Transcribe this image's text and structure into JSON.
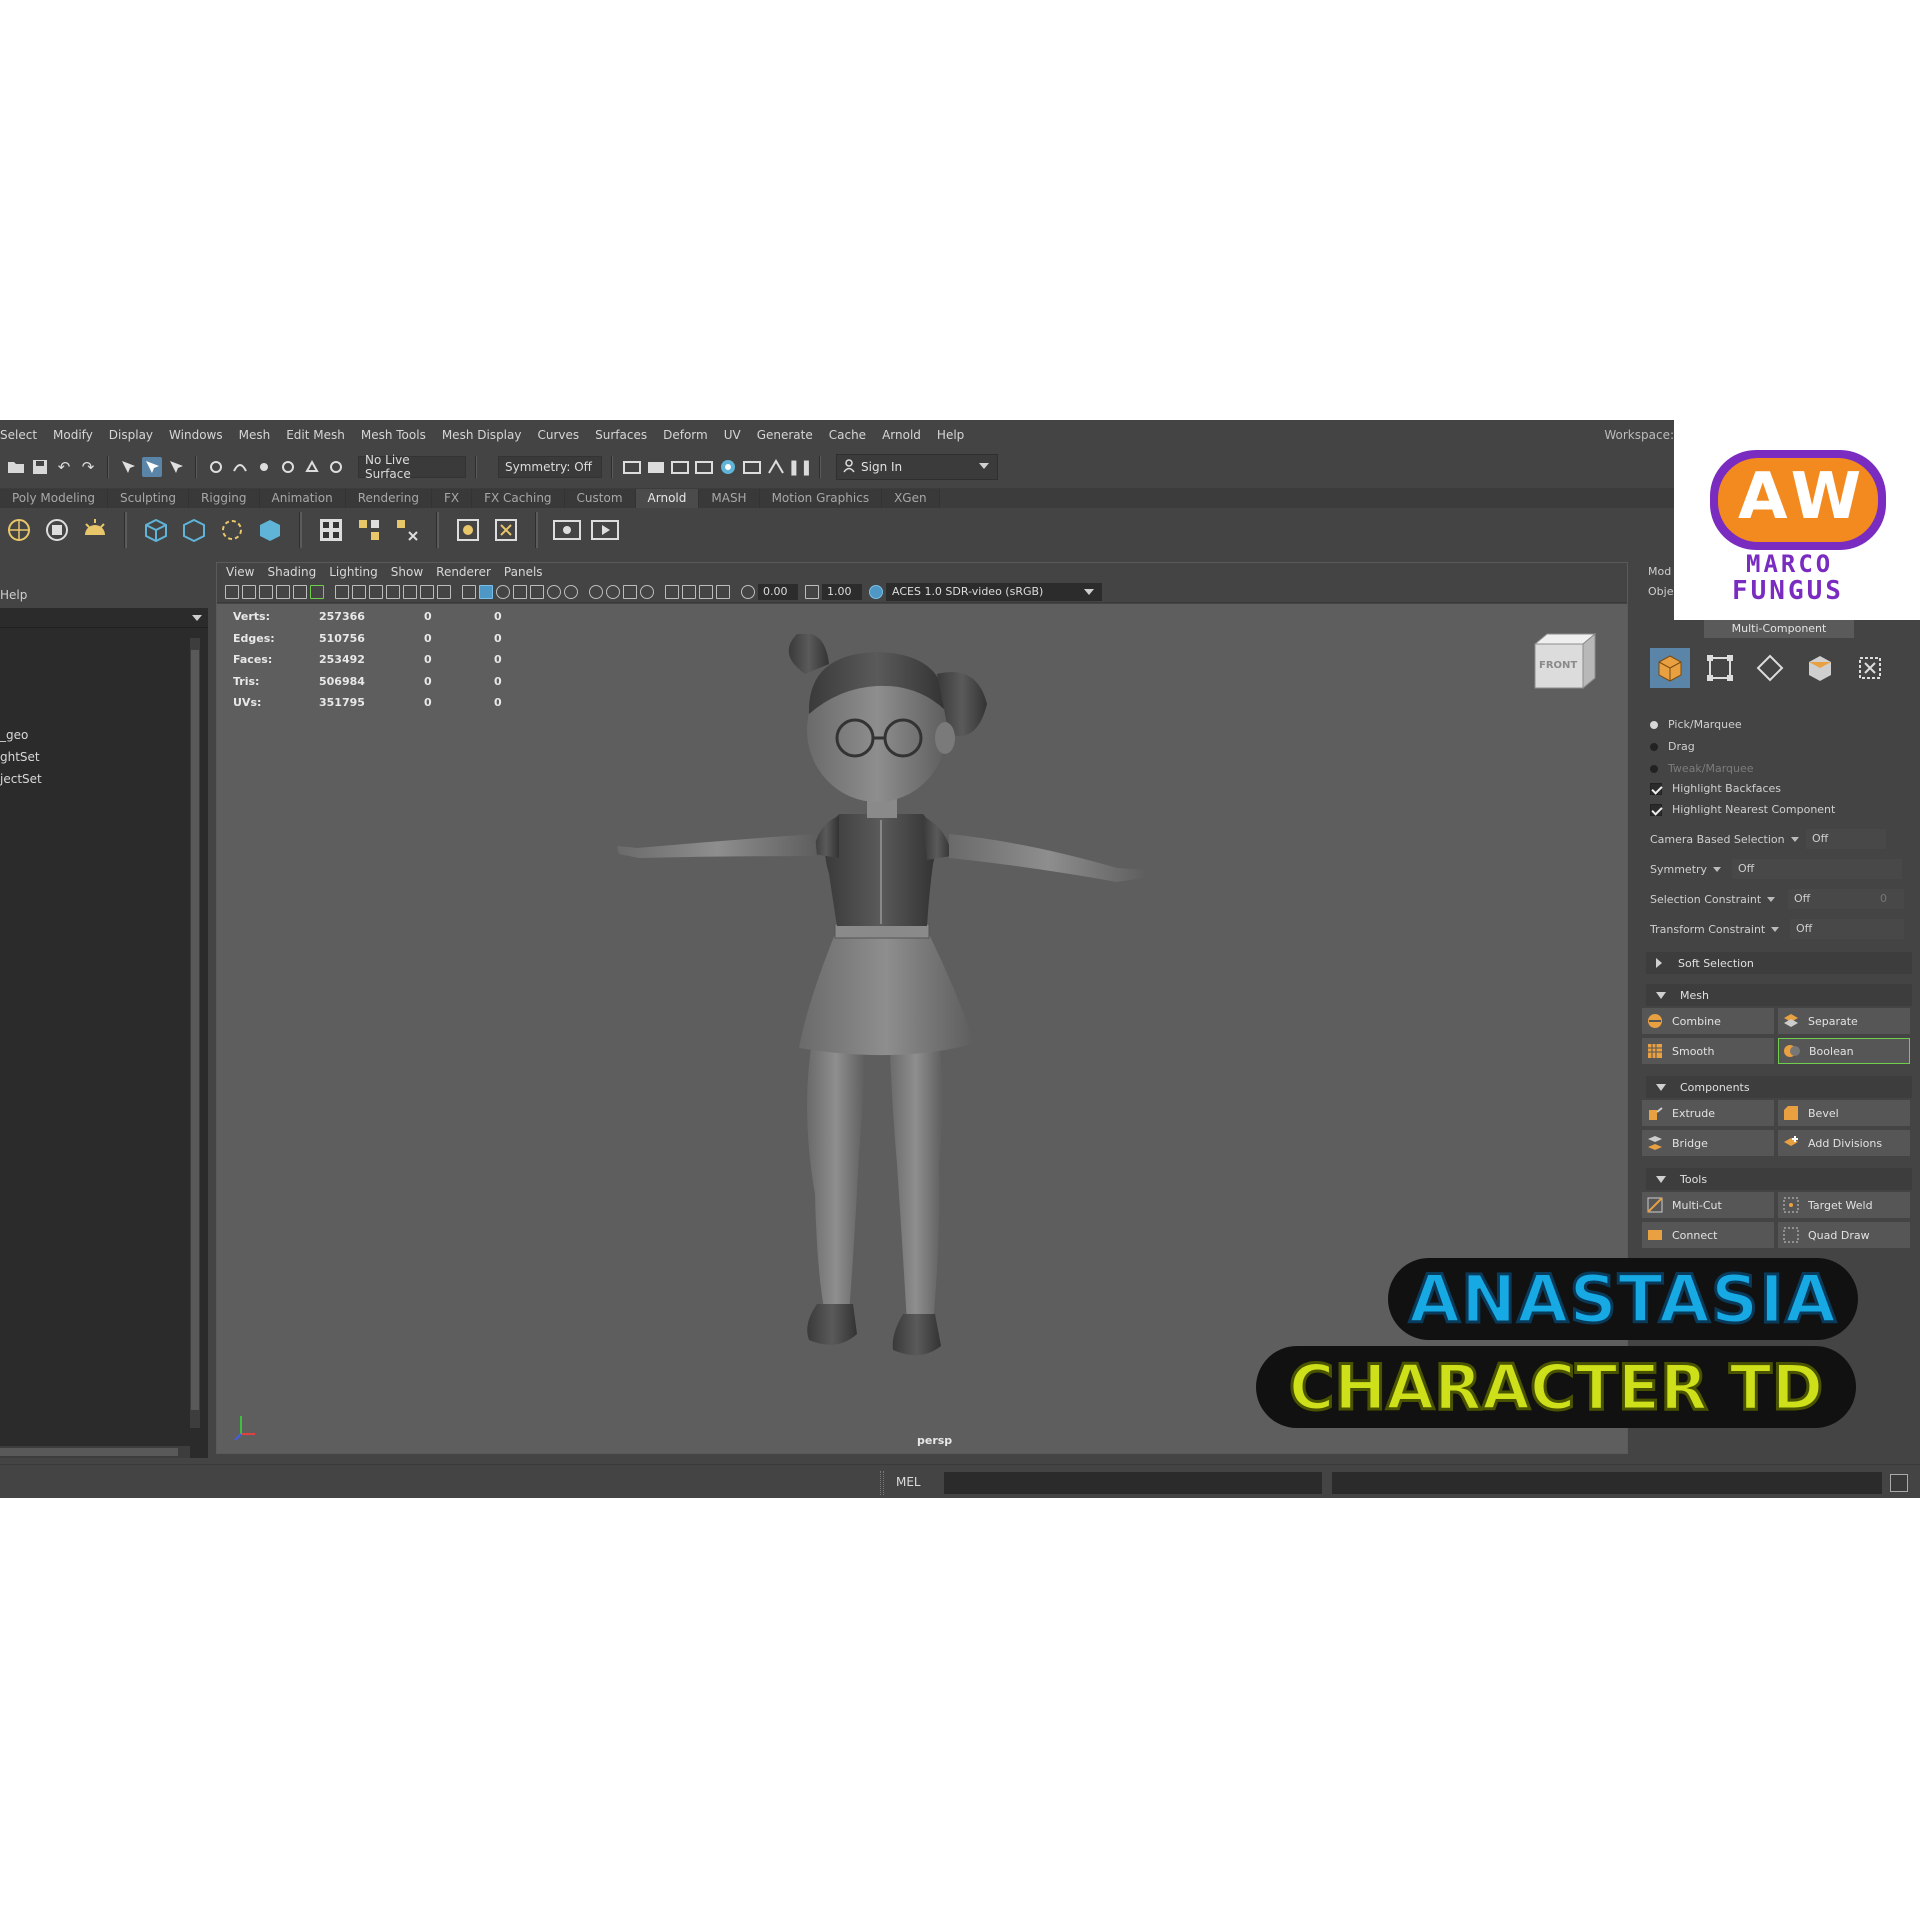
{
  "menubar": {
    "items": [
      "Select",
      "Modify",
      "Display",
      "Windows",
      "Mesh",
      "Edit Mesh",
      "Mesh Tools",
      "Mesh Display",
      "Curves",
      "Surfaces",
      "Deform",
      "UV",
      "Generate",
      "Cache",
      "Arnold",
      "Help"
    ],
    "workspace_label": "Workspace:"
  },
  "statusline": {
    "live_surface": "No Live Surface",
    "symmetry": "Symmetry: Off",
    "sign_in": "Sign In"
  },
  "shelf_tabs": [
    "Poly Modeling",
    "Sculpting",
    "Rigging",
    "Animation",
    "Rendering",
    "FX",
    "FX Caching",
    "Custom",
    "Arnold",
    "MASH",
    "Motion Graphics",
    "XGen"
  ],
  "active_shelf_tab": "Arnold",
  "outliner": {
    "menu_label": "Help",
    "items": [
      "_geo",
      "ghtSet",
      "jectSet"
    ]
  },
  "viewport": {
    "menu": [
      "View",
      "Shading",
      "Lighting",
      "Show",
      "Renderer",
      "Panels"
    ],
    "exposure": "0.00",
    "gamma": "1.00",
    "color_space": "ACES 1.0 SDR-video (sRGB)",
    "camera_label": "persp",
    "viewcube_label": "FRONT",
    "hud": [
      {
        "label": "Verts:",
        "v1": "257366",
        "v2": "0",
        "v3": "0"
      },
      {
        "label": "Edges:",
        "v1": "510756",
        "v2": "0",
        "v3": "0"
      },
      {
        "label": "Faces:",
        "v1": "253492",
        "v2": "0",
        "v3": "0"
      },
      {
        "label": "Tris:",
        "v1": "506984",
        "v2": "0",
        "v3": "0"
      },
      {
        "label": "UVs:",
        "v1": "351795",
        "v2": "0",
        "v3": "0"
      }
    ]
  },
  "toolkit": {
    "tab1": "Mod",
    "tab2": "Objec",
    "multi_component": "Multi-Component",
    "pick_marquee": "Pick/Marquee",
    "drag": "Drag",
    "tweak_marquee": "Tweak/Marquee",
    "highlight_backfaces": "Highlight Backfaces",
    "highlight_nearest": "Highlight Nearest Component",
    "camera_based_selection": {
      "label": "Camera Based Selection",
      "value": "Off"
    },
    "symmetry": {
      "label": "Symmetry",
      "value": "Off"
    },
    "selection_constraint": {
      "label": "Selection Constraint",
      "value": "Off",
      "extra": "0"
    },
    "transform_constraint": {
      "label": "Transform Constraint",
      "value": "Off"
    },
    "soft_selection": "Soft Selection",
    "mesh_section": "Mesh",
    "combine": "Combine",
    "separate": "Separate",
    "smooth": "Smooth",
    "boolean": "Boolean",
    "components_section": "Components",
    "extrude": "Extrude",
    "bevel": "Bevel",
    "bridge": "Bridge",
    "add_divisions": "Add Divisions",
    "tools_section": "Tools",
    "multi_cut": "Multi-Cut",
    "target_weld": "Target Weld",
    "connect_partial": "Connect",
    "quad_draw_partial": "Quad Draw"
  },
  "cmdline": {
    "label": "MEL"
  },
  "logo": {
    "initials": "AW",
    "line1": "MARCO",
    "line2": "FUNGUS"
  },
  "overlay": {
    "title": "ANASTASIA",
    "subtitle": "CHARACTER TD"
  }
}
